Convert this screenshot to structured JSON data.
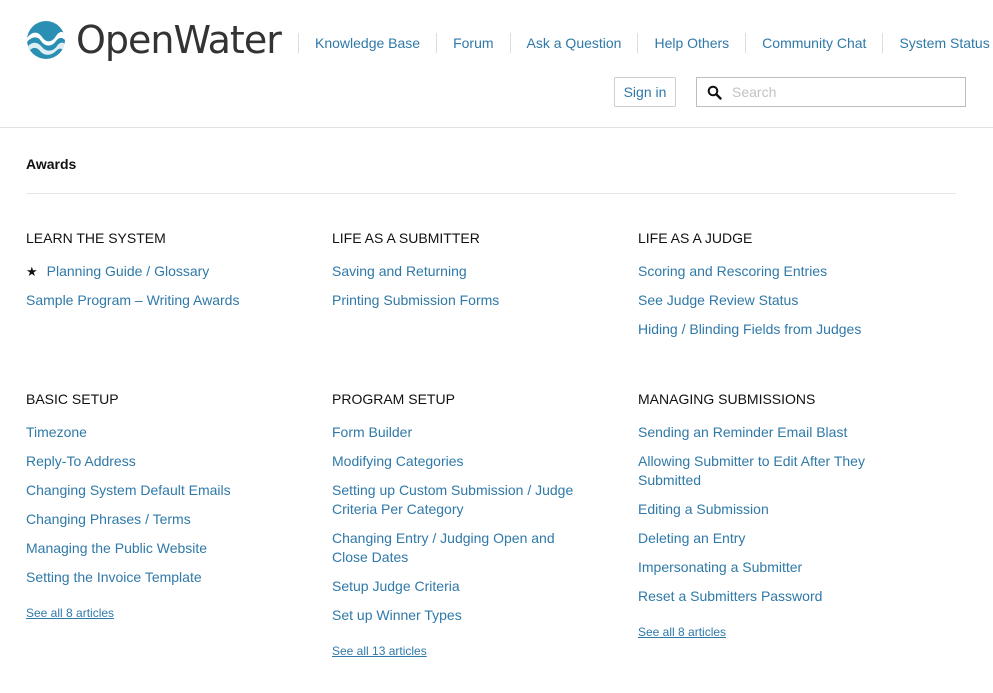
{
  "brand": {
    "name": "OpenWater",
    "color": "#2f79a8"
  },
  "nav": {
    "items": [
      "Knowledge Base",
      "Forum",
      "Ask a Question",
      "Help Others",
      "Community Chat",
      "System Status"
    ]
  },
  "auth": {
    "signin_label": "Sign in"
  },
  "search": {
    "placeholder": "Search",
    "value": ""
  },
  "breadcrumb": {
    "current": "Awards"
  },
  "sections": [
    {
      "title": "LEARN THE SYSTEM",
      "articles": [
        "Planning Guide / Glossary",
        "Sample Program – Writing Awards"
      ],
      "see_all": ""
    },
    {
      "title": "LIFE AS A SUBMITTER",
      "articles": [
        "Saving and Returning",
        "Printing Submission Forms"
      ],
      "see_all": ""
    },
    {
      "title": "LIFE AS A JUDGE",
      "articles": [
        "Scoring and Rescoring Entries",
        "See Judge Review Status",
        "Hiding / Blinding Fields from Judges"
      ],
      "see_all": ""
    },
    {
      "title": "BASIC SETUP",
      "articles": [
        "Timezone",
        "Reply-To Address",
        "Changing System Default Emails",
        "Changing Phrases / Terms",
        "Managing the Public Website",
        "Setting the Invoice Template"
      ],
      "see_all": "See all 8 articles"
    },
    {
      "title": "PROGRAM SETUP",
      "articles": [
        "Form Builder",
        "Modifying Categories",
        "Setting up Custom Submission / Judge Criteria Per Category",
        "Changing Entry / Judging Open and Close Dates",
        "Setup Judge Criteria",
        "Set up Winner Types"
      ],
      "see_all": "See all 13 articles"
    },
    {
      "title": "MANAGING SUBMISSIONS",
      "articles": [
        "Sending an Reminder Email Blast",
        "Allowing Submitter to Edit After They Submitted",
        "Editing a Submission",
        "Deleting an Entry",
        "Impersonating a Submitter",
        "Reset a Submitters Password"
      ],
      "see_all": "See all 8 articles"
    }
  ]
}
